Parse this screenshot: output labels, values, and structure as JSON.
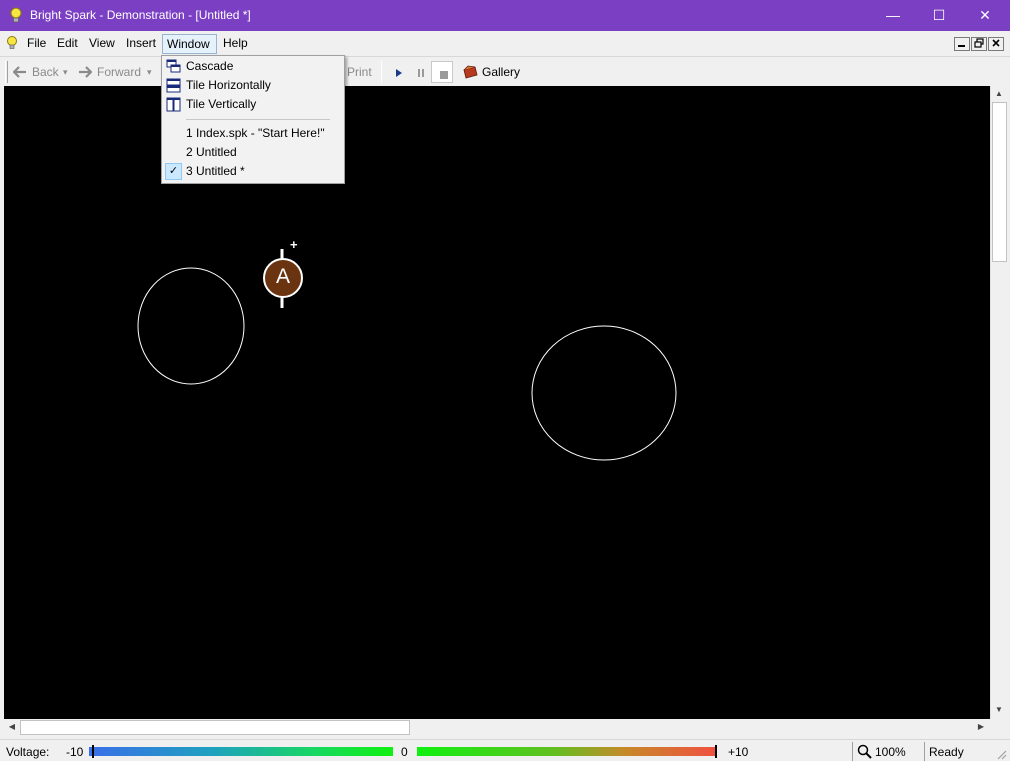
{
  "window": {
    "title": "Bright Spark - Demonstration - [Untitled *]",
    "minimize_glyph": "—",
    "maximize_glyph": "☐",
    "close_glyph": "✕"
  },
  "menubar": {
    "items": [
      {
        "label": "File"
      },
      {
        "label": "Edit"
      },
      {
        "label": "View"
      },
      {
        "label": "Insert"
      },
      {
        "label": "Window"
      },
      {
        "label": "Help"
      }
    ],
    "active": "Window"
  },
  "toolbar": {
    "back_label": "Back",
    "forward_label": "Forward",
    "print_label": "Print",
    "gallery_label": "Gallery",
    "dropdown_glyph": "▾"
  },
  "window_menu": {
    "items": [
      {
        "label": "Cascade",
        "icon": "cascade-icon"
      },
      {
        "label": "Tile Horizontally",
        "icon": "tile-horizontal-icon"
      },
      {
        "label": "Tile Vertically",
        "icon": "tile-vertical-icon"
      }
    ],
    "documents": [
      {
        "label": "1 Index.spk - \"Start Here!\"",
        "checked": false
      },
      {
        "label": "2 Untitled",
        "checked": false
      },
      {
        "label": "3 Untitled *",
        "checked": true
      }
    ],
    "check_glyph": "✓"
  },
  "canvas": {
    "ammeter_label": "A",
    "ammeter_polarity": "+"
  },
  "statusbar": {
    "voltage_label": "Voltage:",
    "min_label": "-10",
    "mid_label": "0",
    "max_label": "+10",
    "zoom_label": "100%",
    "status_label": "Ready"
  },
  "colors": {
    "titlebar": "#7b3fc4",
    "canvas_bg": "#000000",
    "ammeter_fill": "#6b3410"
  }
}
